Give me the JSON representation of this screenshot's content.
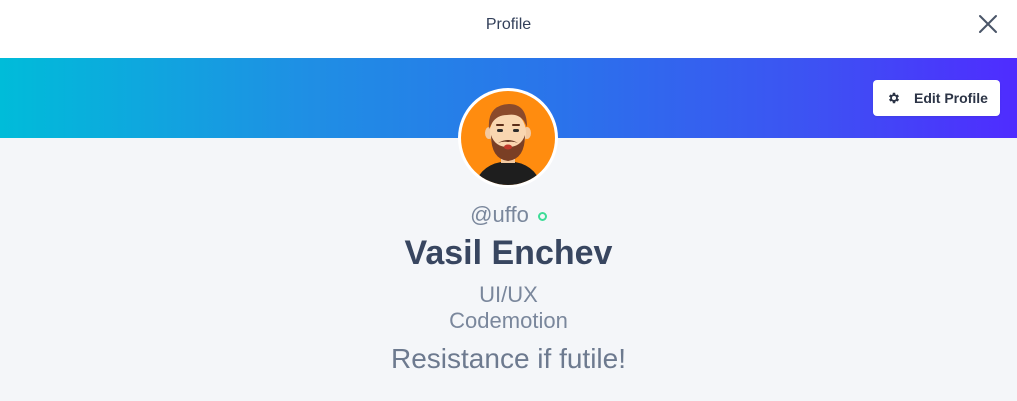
{
  "header": {
    "title": "Profile",
    "close_icon": "close-icon"
  },
  "banner": {
    "gradient_start": "#00bcd9",
    "gradient_end": "#4f2cff"
  },
  "edit_button": {
    "label": "Edit Profile",
    "icon": "gear-icon"
  },
  "profile": {
    "avatar_icon": "bearded-man-avatar",
    "avatar_bg": "#ff8c0f",
    "handle": "@uffo",
    "status_color": "#3ddc97",
    "name": "Vasil Enchev",
    "role": "UI/UX",
    "company": "Codemotion",
    "quote": "Resistance if futile!"
  }
}
